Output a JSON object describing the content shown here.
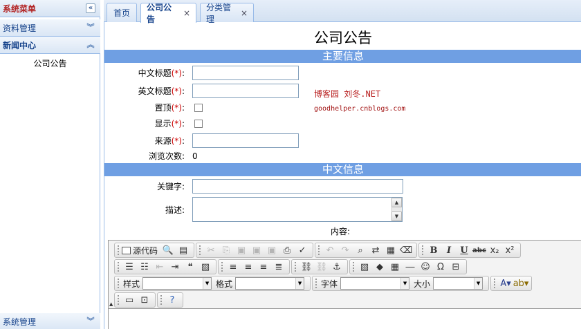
{
  "sidebar": {
    "title": "系统菜单",
    "collapse_icon": "double-chevron-left-icon",
    "sections": [
      {
        "label": "资料管理",
        "icon": "double-chevron-down-icon"
      },
      {
        "label": "新闻中心",
        "icon": "double-chevron-up-icon"
      }
    ],
    "news_items": [
      "公司公告"
    ],
    "bottom_section": {
      "label": "系统管理",
      "icon": "double-chevron-down-icon"
    }
  },
  "tabs": [
    {
      "label": "首页",
      "closable": false,
      "active": false
    },
    {
      "label": "公司公告",
      "closable": true,
      "active": true
    },
    {
      "label": "分类管理",
      "closable": true,
      "active": false
    }
  ],
  "close_glyph": "×",
  "form": {
    "page_title": "公司公告",
    "section_main": "主要信息",
    "section_cn": "中文信息",
    "labels": {
      "cn_title": "中文标题",
      "en_title": "英文标题",
      "pin": "置顶",
      "show": "显示",
      "source": "来源",
      "views": "浏览次数:",
      "keywords": "关键字:",
      "description": "描述:",
      "content": "内容:"
    },
    "required_mark": "(*)",
    "colon": ":",
    "values": {
      "cn_title": "",
      "en_title": "",
      "source": "",
      "views": "0",
      "keywords": "",
      "description": ""
    },
    "watermark_1": "博客园 刘冬.NET",
    "watermark_2": "goodhelper.cnblogs.com"
  },
  "editor": {
    "source_label": "源代码",
    "style_label": "样式",
    "format_label": "格式",
    "font_label": "字体",
    "size_label": "大小",
    "style_value": "",
    "format_value": "",
    "font_value": "",
    "size_value": ""
  },
  "colors": {
    "section_band": "#6f9fe3",
    "required": "#cc0000",
    "watermark": "#b71c1c",
    "sidebar_title": "#b22222"
  }
}
